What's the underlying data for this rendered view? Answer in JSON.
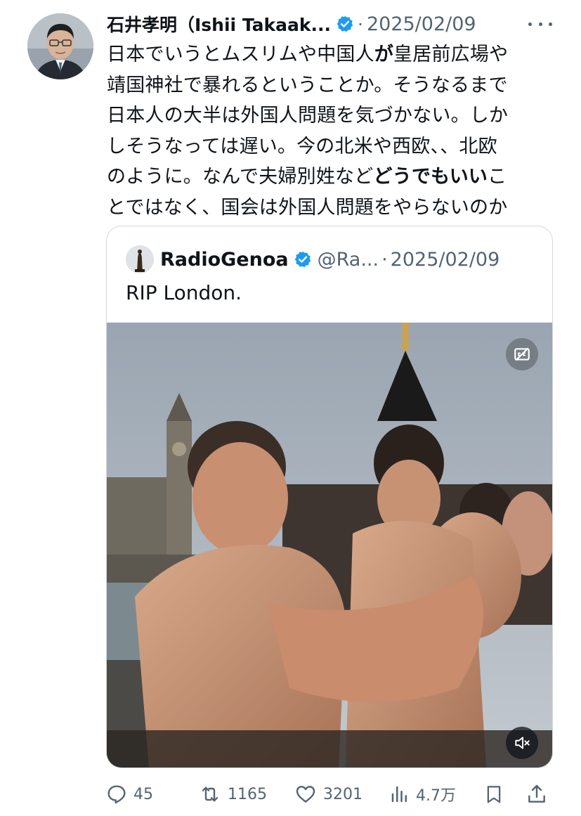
{
  "post": {
    "author_name": "石井孝明（Ishii Takaak...",
    "separator": "·",
    "date": "2025/02/09",
    "text_lines": [
      [
        "日本でいうとムスリムや中国人",
        "が",
        "皇居前広場や"
      ],
      [
        "靖国神社で暴れるということか。そうなるまで",
        "",
        ""
      ],
      [
        "日本人の大半は外国人問題を気づかない。しか",
        "",
        ""
      ],
      [
        "しそうなっては遅い。今の北米や西欧、、北欧",
        "",
        ""
      ],
      [
        "のように。なんで夫婦別姓など",
        "どうでもいい",
        "こ"
      ],
      [
        "とではなく、国会は外国人問題をやらないのか",
        "",
        ""
      ]
    ]
  },
  "quote": {
    "name": "RadioGenoa",
    "handle": "@Ra...",
    "separator": "·",
    "date": "2025/02/09",
    "text": "RIP London."
  },
  "actions": {
    "replies": "45",
    "reposts": "1165",
    "likes": "3201",
    "views": "4.7万"
  },
  "icons": {
    "verified": "verified-badge-icon",
    "more": "more-icon",
    "captions": "captions-off-icon",
    "mute": "muted-speaker-icon",
    "reply": "reply-icon",
    "repost": "repost-icon",
    "like": "heart-icon",
    "views": "views-chart-icon",
    "bookmark": "bookmark-icon",
    "share": "share-icon"
  },
  "colors": {
    "verified_blue": "#1d9bf0",
    "text_primary": "#0f1419",
    "text_secondary": "#536471",
    "border": "#cfd9de"
  }
}
